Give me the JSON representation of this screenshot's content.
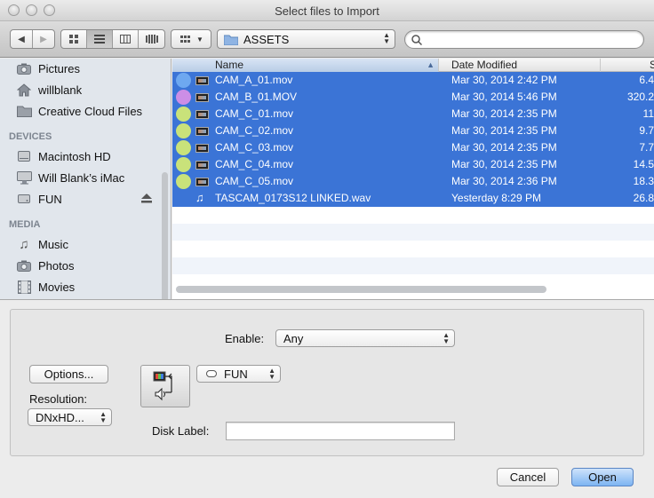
{
  "window": {
    "title": "Select files to Import"
  },
  "toolbar": {
    "location": "ASSETS"
  },
  "sidebar": {
    "favorites": [
      {
        "label": "Pictures",
        "icon": "camera-icon"
      },
      {
        "label": "willblank",
        "icon": "home-icon"
      },
      {
        "label": "Creative Cloud Files",
        "icon": "folder-icon"
      }
    ],
    "devices_header": "DEVICES",
    "devices": [
      {
        "label": "Macintosh HD",
        "icon": "harddrive-icon"
      },
      {
        "label": "Will Blank’s iMac",
        "icon": "imac-icon"
      },
      {
        "label": "FUN",
        "icon": "drive-icon",
        "eject": "eject-icon"
      }
    ],
    "media_header": "MEDIA",
    "media": [
      {
        "label": "Music",
        "icon": "music-note-icon"
      },
      {
        "label": "Photos",
        "icon": "camera-icon"
      },
      {
        "label": "Movies",
        "icon": "film-icon"
      }
    ]
  },
  "filelist": {
    "columns": {
      "name": "Name",
      "date": "Date Modified",
      "size": "S"
    },
    "files": [
      {
        "name": "CAM_A_01.mov",
        "date": "Mar 30, 2014 2:42 PM",
        "size": "6.4",
        "tag": "#6ea8f0",
        "type": "video"
      },
      {
        "name": "CAM_B_01.MOV",
        "date": "Mar 30, 2014 5:46 PM",
        "size": "320.2",
        "tag": "#cc8ee6",
        "type": "video"
      },
      {
        "name": "CAM_C_01.mov",
        "date": "Mar 30, 2014 2:35 PM",
        "size": "11",
        "tag": "#c9e27a",
        "type": "video"
      },
      {
        "name": "CAM_C_02.mov",
        "date": "Mar 30, 2014 2:35 PM",
        "size": "9.7",
        "tag": "#c9e27a",
        "type": "video"
      },
      {
        "name": "CAM_C_03.mov",
        "date": "Mar 30, 2014 2:35 PM",
        "size": "7.7",
        "tag": "#c9e27a",
        "type": "video"
      },
      {
        "name": "CAM_C_04.mov",
        "date": "Mar 30, 2014 2:35 PM",
        "size": "14.5",
        "tag": "#c9e27a",
        "type": "video"
      },
      {
        "name": "CAM_C_05.mov",
        "date": "Mar 30, 2014 2:36 PM",
        "size": "18.3",
        "tag": "#c9e27a",
        "type": "video"
      },
      {
        "name": "TASCAM_0173S12 LINKED.wav",
        "date": "Yesterday 8:29 PM",
        "size": "26.8",
        "tag": "",
        "type": "audio"
      }
    ],
    "selection_color": "#3b74d6"
  },
  "options": {
    "enable_label": "Enable:",
    "enable_value": "Any",
    "options_button": "Options...",
    "resolution_label": "Resolution:",
    "resolution_value": "DNxHD...",
    "drive_value": "FUN",
    "disk_label_label": "Disk Label:",
    "disk_label_value": ""
  },
  "footer": {
    "cancel": "Cancel",
    "open": "Open"
  }
}
